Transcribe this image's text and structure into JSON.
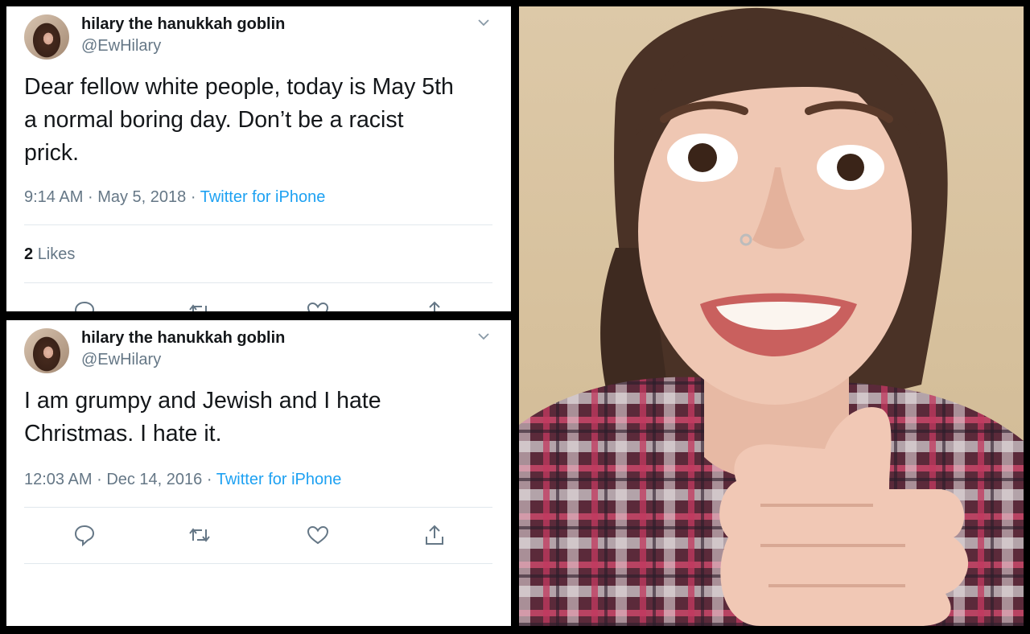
{
  "tweets": [
    {
      "display_name": "hilary the hanukkah goblin",
      "handle": "@EwHilary",
      "text_lines": [
        "Dear fellow white people, today is May 5th",
        "a normal boring day. Don’t be a racist",
        "prick."
      ],
      "time": "9:14 AM",
      "date": "May 5, 2018",
      "source": "Twitter for iPhone",
      "likes_count": "2",
      "likes_label": "Likes"
    },
    {
      "display_name": "hilary the hanukkah goblin",
      "handle": "@EwHilary",
      "text_lines": [
        "I am grumpy and Jewish and I hate",
        "Christmas. I hate it."
      ],
      "time": "12:03 AM",
      "date": "Dec 14, 2016",
      "source": "Twitter for iPhone"
    }
  ],
  "separator": "·",
  "colors": {
    "link": "#1da1f2",
    "secondary": "#657786",
    "primary_text": "#14171a",
    "divider": "#e1e8ed"
  },
  "icons": [
    "reply-icon",
    "retweet-icon",
    "like-icon",
    "share-icon",
    "chevron-down-icon"
  ]
}
